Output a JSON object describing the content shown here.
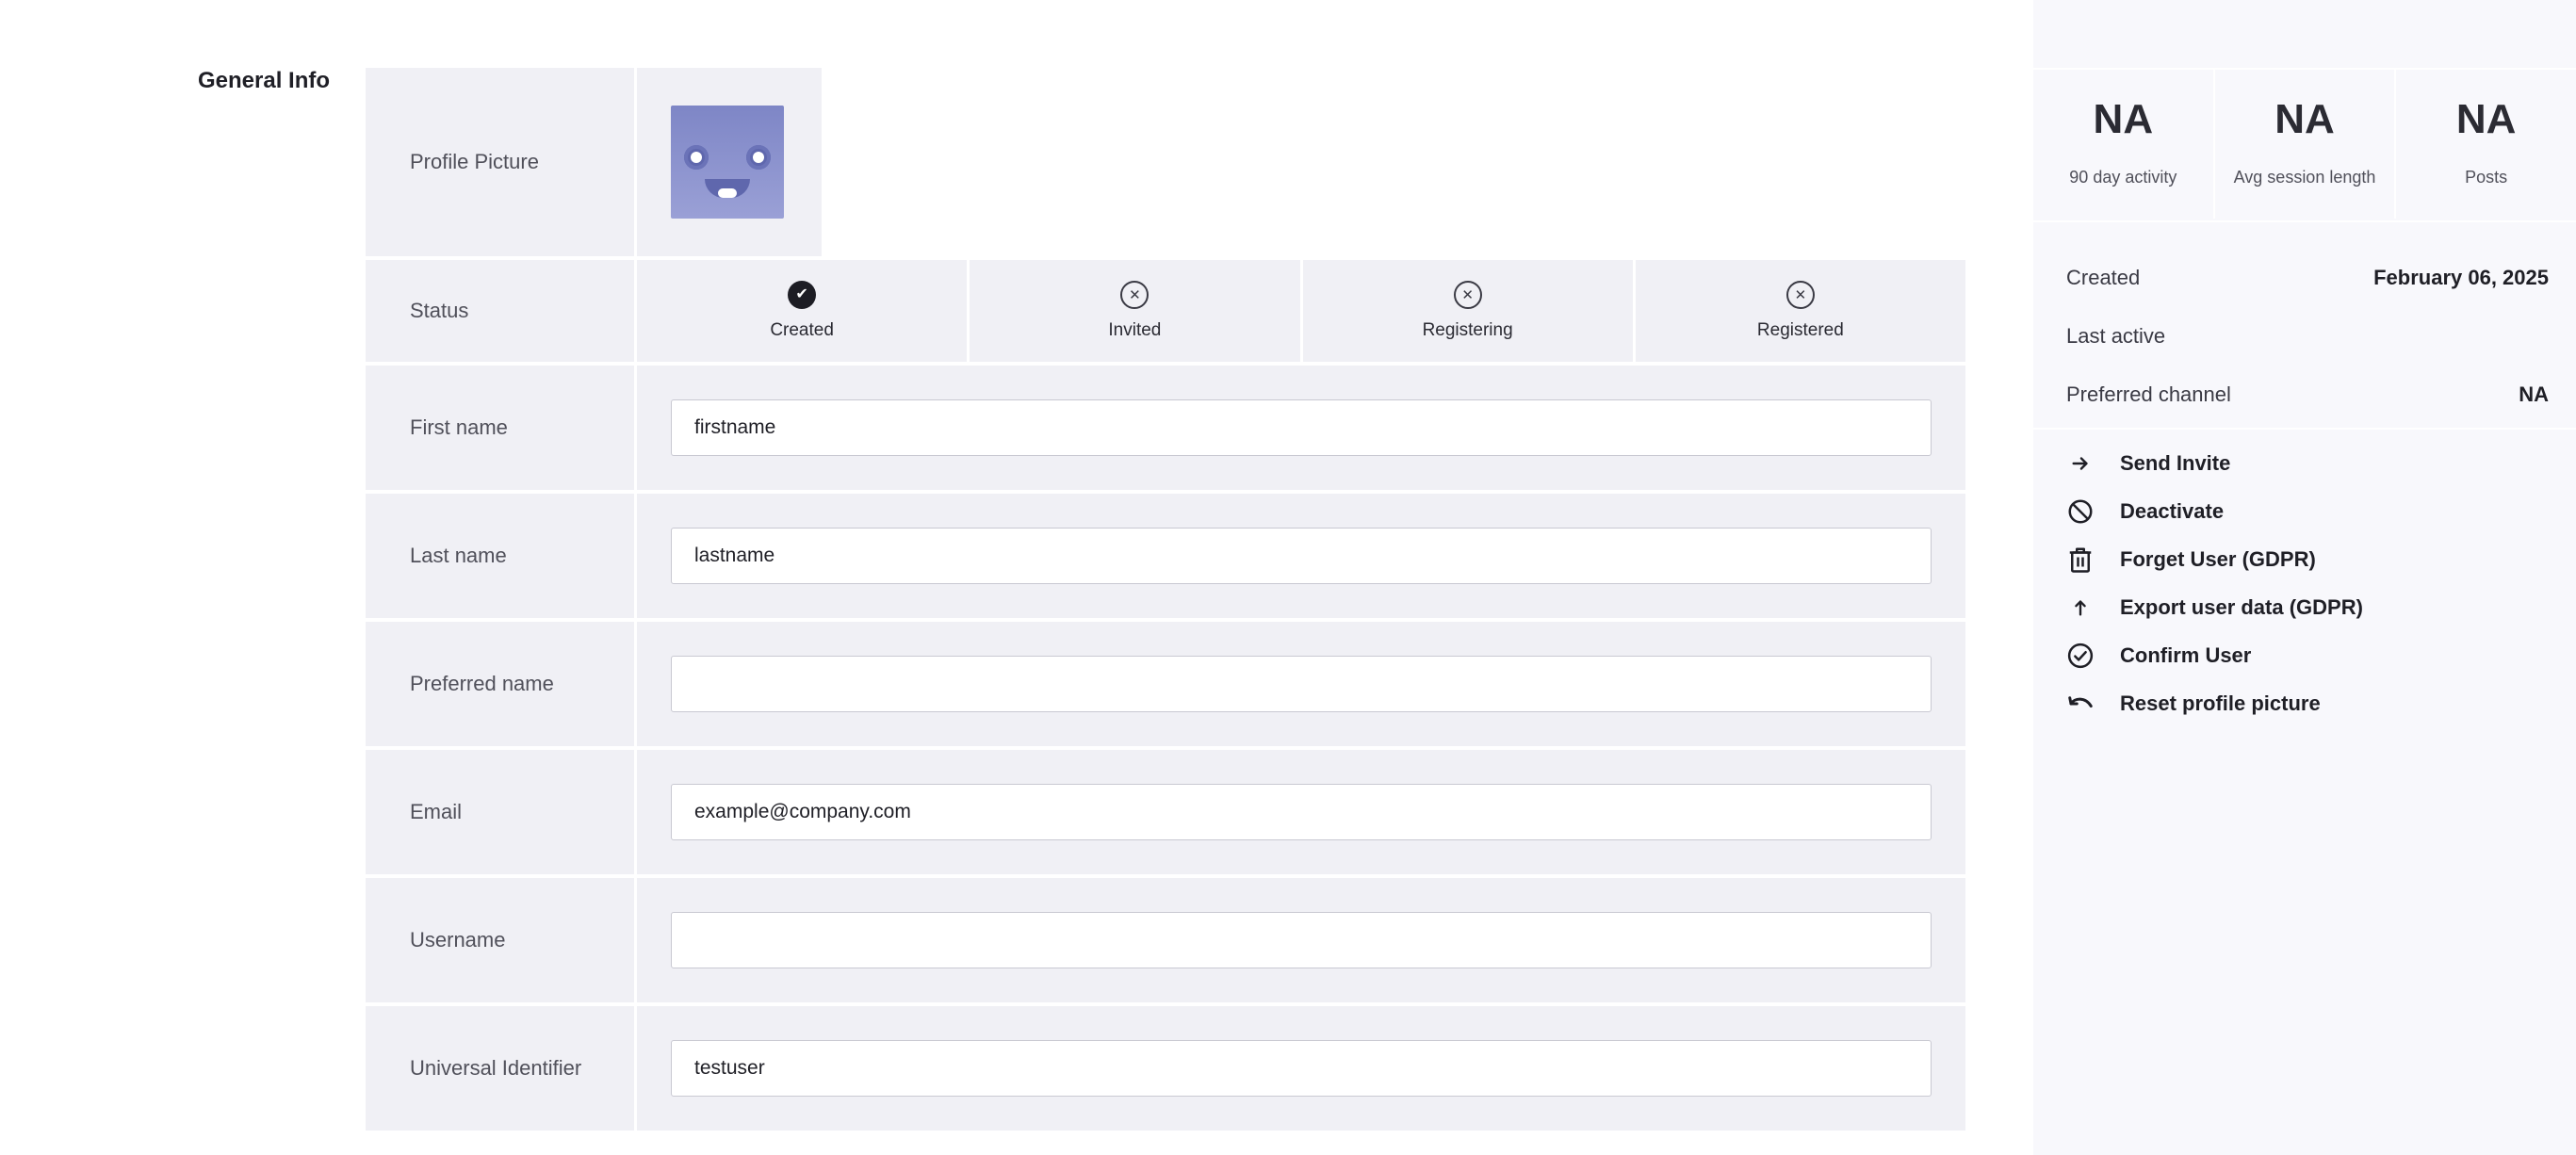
{
  "section": {
    "title": "General Info"
  },
  "form": {
    "profile_label": "Profile Picture",
    "status_label": "Status",
    "status_steps": [
      {
        "label": "Created",
        "state": "done",
        "icon": "check-circle-icon"
      },
      {
        "label": "Invited",
        "state": "pending",
        "icon": "x-circle-icon"
      },
      {
        "label": "Registering",
        "state": "pending",
        "icon": "x-circle-icon"
      },
      {
        "label": "Registered",
        "state": "pending",
        "icon": "x-circle-icon"
      }
    ],
    "fields": [
      {
        "label": "First name",
        "value": "firstname"
      },
      {
        "label": "Last name",
        "value": "lastname"
      },
      {
        "label": "Preferred name",
        "value": ""
      },
      {
        "label": "Email",
        "value": "example@company.com"
      },
      {
        "label": "Username",
        "value": ""
      },
      {
        "label": "Universal Identifier",
        "value": "testuser"
      }
    ]
  },
  "sidebar": {
    "stats": [
      {
        "value": "NA",
        "label": "90 day activity"
      },
      {
        "value": "NA",
        "label": "Avg session length"
      },
      {
        "value": "NA",
        "label": "Posts"
      }
    ],
    "meta": [
      {
        "label": "Created",
        "value": "February 06, 2025"
      },
      {
        "label": "Last active",
        "value": ""
      },
      {
        "label": "Preferred channel",
        "value": "NA"
      }
    ],
    "actions": [
      {
        "label": "Send Invite",
        "icon": "arrow-right-icon"
      },
      {
        "label": "Deactivate",
        "icon": "ban-icon"
      },
      {
        "label": "Forget User (GDPR)",
        "icon": "trash-icon"
      },
      {
        "label": "Export user data (GDPR)",
        "icon": "arrow-up-icon"
      },
      {
        "label": "Confirm User",
        "icon": "check-circle-outline-icon"
      },
      {
        "label": "Reset profile picture",
        "icon": "undo-icon"
      }
    ]
  },
  "colors": {
    "panel": "#f0f0f5",
    "sidebar": "#f8f8fc",
    "text": "#1f1f26",
    "avatar": "#8a91cd"
  }
}
